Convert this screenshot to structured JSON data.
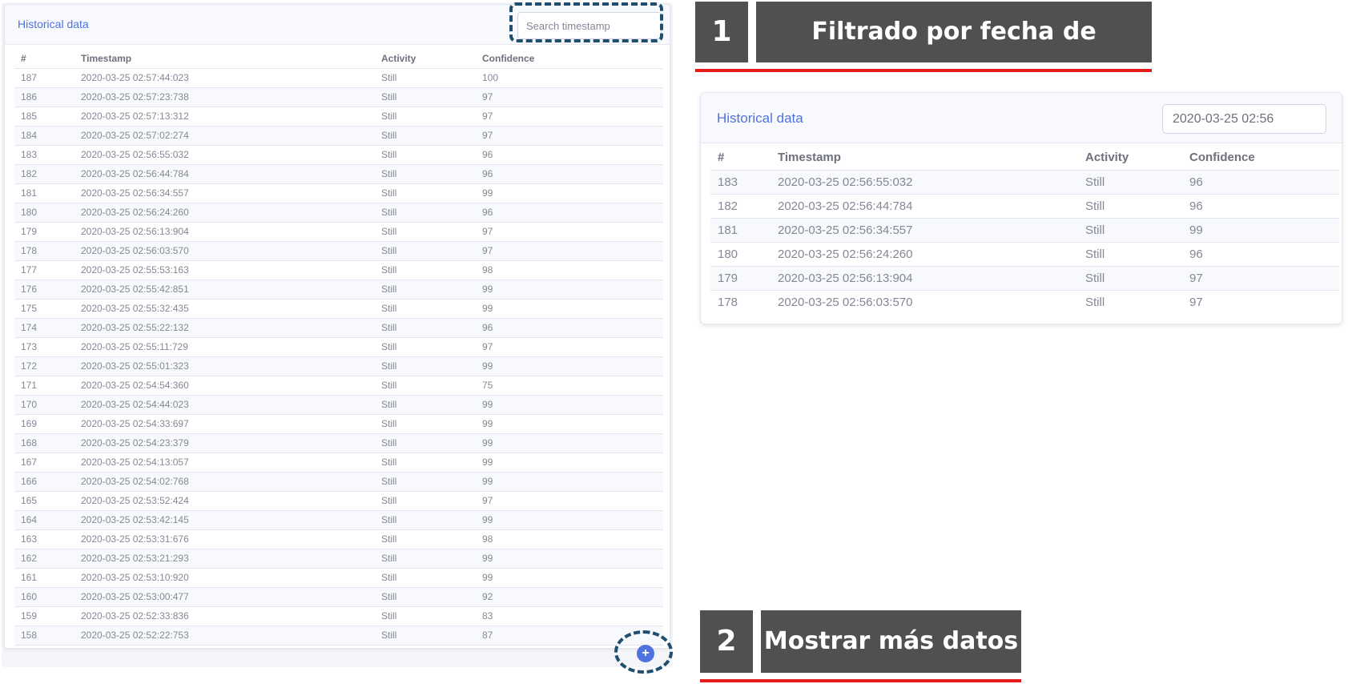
{
  "left_panel": {
    "title": "Historical data",
    "search_placeholder": "Search timestamp",
    "columns": [
      "#",
      "Timestamp",
      "Activity",
      "Confidence"
    ],
    "rows": [
      [
        "187",
        "2020-03-25 02:57:44:023",
        "Still",
        "100"
      ],
      [
        "186",
        "2020-03-25 02:57:23:738",
        "Still",
        "97"
      ],
      [
        "185",
        "2020-03-25 02:57:13:312",
        "Still",
        "97"
      ],
      [
        "184",
        "2020-03-25 02:57:02:274",
        "Still",
        "97"
      ],
      [
        "183",
        "2020-03-25 02:56:55:032",
        "Still",
        "96"
      ],
      [
        "182",
        "2020-03-25 02:56:44:784",
        "Still",
        "96"
      ],
      [
        "181",
        "2020-03-25 02:56:34:557",
        "Still",
        "99"
      ],
      [
        "180",
        "2020-03-25 02:56:24:260",
        "Still",
        "96"
      ],
      [
        "179",
        "2020-03-25 02:56:13:904",
        "Still",
        "97"
      ],
      [
        "178",
        "2020-03-25 02:56:03:570",
        "Still",
        "97"
      ],
      [
        "177",
        "2020-03-25 02:55:53:163",
        "Still",
        "98"
      ],
      [
        "176",
        "2020-03-25 02:55:42:851",
        "Still",
        "99"
      ],
      [
        "175",
        "2020-03-25 02:55:32:435",
        "Still",
        "99"
      ],
      [
        "174",
        "2020-03-25 02:55:22:132",
        "Still",
        "96"
      ],
      [
        "173",
        "2020-03-25 02:55:11:729",
        "Still",
        "97"
      ],
      [
        "172",
        "2020-03-25 02:55:01:323",
        "Still",
        "99"
      ],
      [
        "171",
        "2020-03-25 02:54:54:360",
        "Still",
        "75"
      ],
      [
        "170",
        "2020-03-25 02:54:44:023",
        "Still",
        "99"
      ],
      [
        "169",
        "2020-03-25 02:54:33:697",
        "Still",
        "99"
      ],
      [
        "168",
        "2020-03-25 02:54:23:379",
        "Still",
        "99"
      ],
      [
        "167",
        "2020-03-25 02:54:13:057",
        "Still",
        "99"
      ],
      [
        "166",
        "2020-03-25 02:54:02:768",
        "Still",
        "99"
      ],
      [
        "165",
        "2020-03-25 02:53:52:424",
        "Still",
        "97"
      ],
      [
        "164",
        "2020-03-25 02:53:42:145",
        "Still",
        "99"
      ],
      [
        "163",
        "2020-03-25 02:53:31:676",
        "Still",
        "98"
      ],
      [
        "162",
        "2020-03-25 02:53:21:293",
        "Still",
        "99"
      ],
      [
        "161",
        "2020-03-25 02:53:10:920",
        "Still",
        "99"
      ],
      [
        "160",
        "2020-03-25 02:53:00:477",
        "Still",
        "92"
      ],
      [
        "159",
        "2020-03-25 02:52:33:836",
        "Still",
        "83"
      ],
      [
        "158",
        "2020-03-25 02:52:22:753",
        "Still",
        "87"
      ]
    ],
    "more_button_icon": "plus-icon",
    "more_button_symbol": "+"
  },
  "callouts": {
    "filter": {
      "number": "1",
      "label": "Filtrado por fecha de captura"
    },
    "more": {
      "number": "2",
      "label": "Mostrar más datos"
    }
  },
  "right_panel": {
    "title": "Historical data",
    "search_value": "2020-03-25 02:56",
    "columns": [
      "#",
      "Timestamp",
      "Activity",
      "Confidence"
    ],
    "rows": [
      [
        "183",
        "2020-03-25 02:56:55:032",
        "Still",
        "96"
      ],
      [
        "182",
        "2020-03-25 02:56:44:784",
        "Still",
        "96"
      ],
      [
        "181",
        "2020-03-25 02:56:34:557",
        "Still",
        "99"
      ],
      [
        "180",
        "2020-03-25 02:56:24:260",
        "Still",
        "96"
      ],
      [
        "179",
        "2020-03-25 02:56:13:904",
        "Still",
        "97"
      ],
      [
        "178",
        "2020-03-25 02:56:03:570",
        "Still",
        "97"
      ]
    ]
  },
  "colors": {
    "accent": "#4e73df",
    "callout_bg": "#505050",
    "callout_underline": "#e31b1b",
    "highlight_dash": "#1f4e6e"
  }
}
